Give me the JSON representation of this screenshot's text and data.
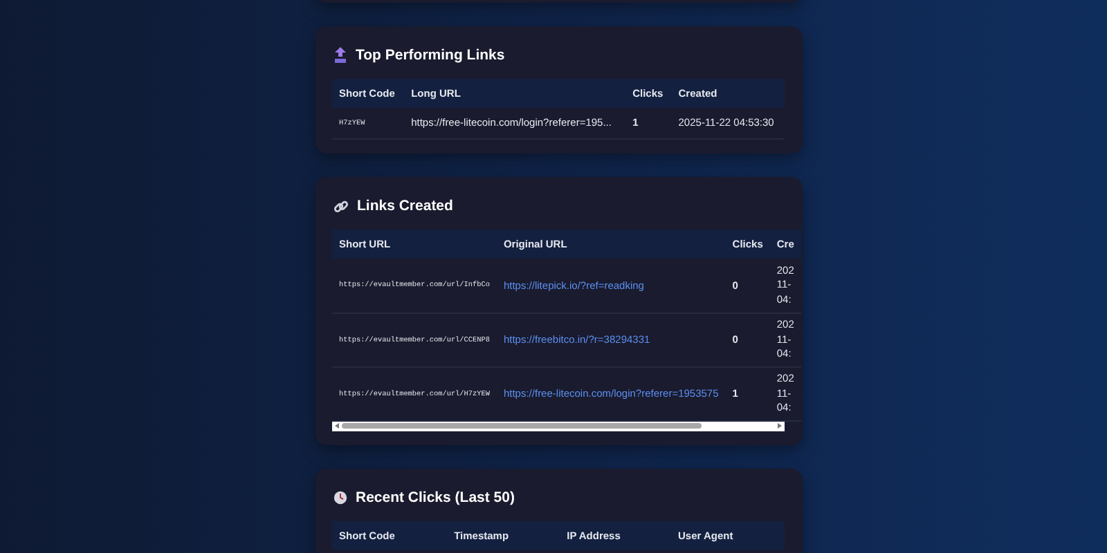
{
  "top_links": {
    "title": "Top Performing Links",
    "columns": [
      "Short Code",
      "Long URL",
      "Clicks",
      "Created"
    ],
    "rows": [
      {
        "short_code": "H7zYEW",
        "long_url": "https://free-litecoin.com/login?referer=195...",
        "clicks": "1",
        "created": "2025-11-22 04:53:30"
      }
    ]
  },
  "links_created": {
    "title": "Links Created",
    "columns": [
      "Short URL",
      "Original URL",
      "Clicks",
      "Cre"
    ],
    "rows": [
      {
        "short_url": "https://evaultmember.com/url/InfbCo",
        "original_url": "https://litepick.io/?ref=readking",
        "clicks": "0",
        "created": [
          "202",
          "11-",
          "04:"
        ]
      },
      {
        "short_url": "https://evaultmember.com/url/CCENP8",
        "original_url": "https://freebitco.in/?r=38294331",
        "clicks": "0",
        "created": [
          "202",
          "11-",
          "04:"
        ]
      },
      {
        "short_url": "https://evaultmember.com/url/H7zYEW",
        "original_url": "https://free-litecoin.com/login?referer=1953575",
        "clicks": "1",
        "created": [
          "202",
          "11-",
          "04:"
        ]
      }
    ]
  },
  "recent_clicks": {
    "title": "Recent Clicks (Last 50)",
    "columns": [
      "Short Code",
      "Timestamp",
      "IP Address",
      "User Agent"
    ]
  }
}
